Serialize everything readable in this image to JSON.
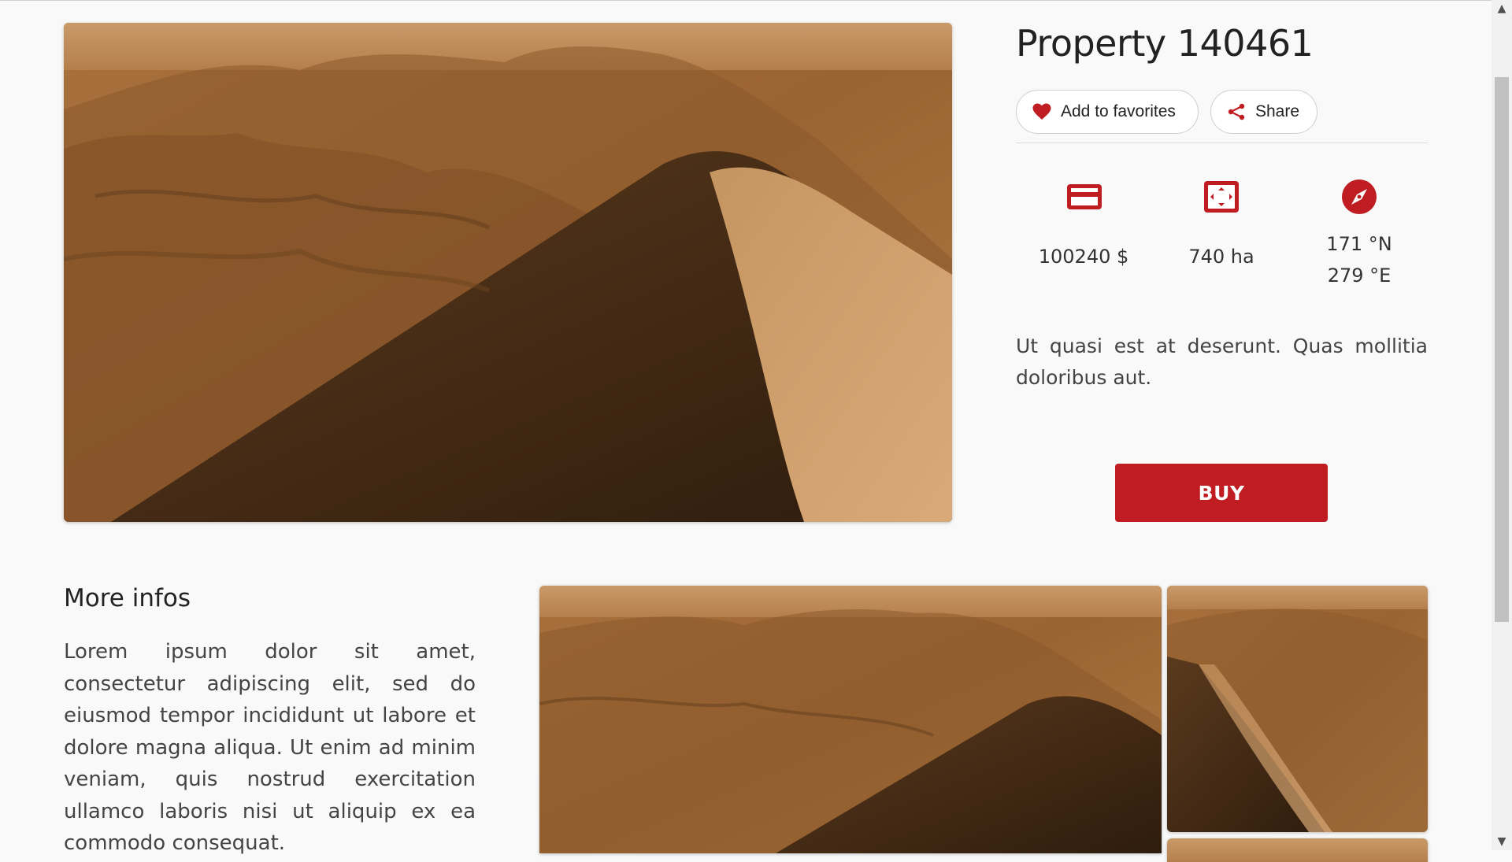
{
  "property": {
    "title": "Property 140461",
    "favorite_label": "Add to favorites",
    "share_label": "Share",
    "price": "100240 $",
    "area": "740 ha",
    "coordinates": {
      "lat": "171 °N",
      "lon": "279 °E"
    },
    "description": "Ut quasi est at deserunt. Quas mollitia doloribus aut.",
    "buy_label": "BUY"
  },
  "more_infos": {
    "heading": "More infos",
    "text": "Lorem ipsum dolor sit amet, consectetur adipiscing elit, sed do eiusmod tempor incididunt ut labore et dolore magna aliqua. Ut enim ad minim veniam, quis nostrud exercitation ullamco laboris nisi ut aliquip ex ea commodo consequat."
  },
  "icons": {
    "favorite": "heart-icon",
    "share": "share-icon",
    "price": "credit-card-icon",
    "area": "area-expand-icon",
    "coordinates": "compass-icon"
  },
  "colors": {
    "accent": "#bf1d22",
    "background": "#f9f9f9"
  }
}
